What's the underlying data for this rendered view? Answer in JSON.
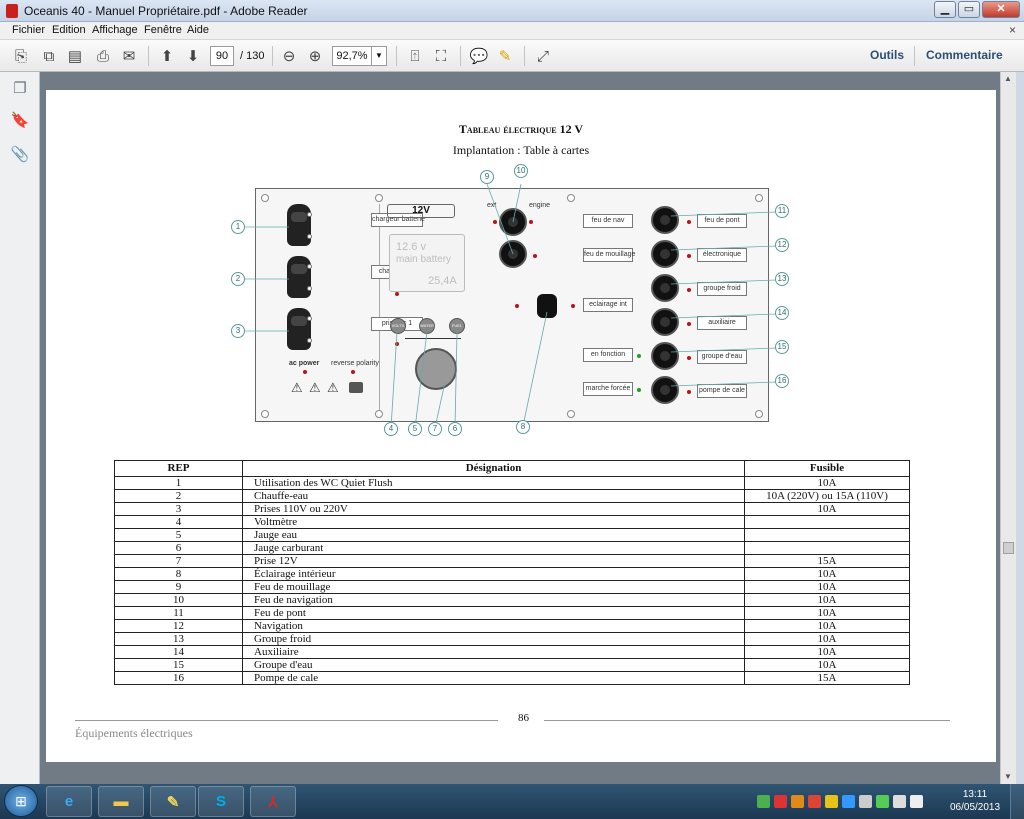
{
  "window": {
    "title": "Oceanis 40 - Manuel Propriétaire.pdf - Adobe Reader",
    "minimize_icon": "minimize-icon",
    "maximize_icon": "maximize-icon",
    "close_icon": "close-icon"
  },
  "menu": {
    "items": [
      "Fichier",
      "Edition",
      "Affichage",
      "Fenêtre",
      "Aide"
    ],
    "close_glyph": "×"
  },
  "toolbar": {
    "page_current": "90",
    "page_total": "/ 130",
    "zoom": "92,7%",
    "tools_label": "Outils",
    "comment_label": "Commentaire"
  },
  "page": {
    "title": "Tableau électrique 12 V",
    "subtitle": "Implantation : Table à cartes",
    "diagram": {
      "labels_left": [
        "chargeur batterie",
        "chauffe eau",
        "prise ac 1"
      ],
      "ac_power": "ac power",
      "reverse_polarity": "reverse polarity",
      "voltage_label": "12V",
      "lcd_line1": "12.6 v",
      "lcd_line2": "main battery",
      "lcd_line3": "25,4A",
      "knob_labels": [
        "VOLTS",
        "WATER",
        "FUEL"
      ],
      "anchor_labels": [
        "ext",
        "engine"
      ],
      "middle_labels": [
        "feu de nav",
        "feu de mouillage",
        "eclairage int",
        "en fonction",
        "marche forcée"
      ],
      "right_labels": [
        "feu de pont",
        "électronique",
        "groupe froid",
        "auxiliaire",
        "groupe d'eau",
        "pompe de cale"
      ],
      "callouts": [
        "1",
        "2",
        "3",
        "4",
        "5",
        "7",
        "6",
        "8",
        "9",
        "10",
        "11",
        "12",
        "13",
        "14",
        "15",
        "16"
      ]
    },
    "table": {
      "headers": [
        "REP",
        "Désignation",
        "Fusible"
      ],
      "rows": [
        [
          "1",
          "Utilisation des WC Quiet Flush",
          "10A"
        ],
        [
          "2",
          "Chauffe-eau",
          "10A (220V) ou 15A (110V)"
        ],
        [
          "3",
          "Prises 110V ou 220V",
          "10A"
        ],
        [
          "4",
          "Voltmètre",
          ""
        ],
        [
          "5",
          "Jauge eau",
          ""
        ],
        [
          "6",
          "Jauge carburant",
          ""
        ],
        [
          "7",
          "Prise 12V",
          "15A"
        ],
        [
          "8",
          "Éclairage intérieur",
          "10A"
        ],
        [
          "9",
          "Feu de mouillage",
          "10A"
        ],
        [
          "10",
          "Feu de navigation",
          "10A"
        ],
        [
          "11",
          "Feu de pont",
          "10A"
        ],
        [
          "12",
          "Navigation",
          "10A"
        ],
        [
          "13",
          "Groupe froid",
          "10A"
        ],
        [
          "14",
          "Auxiliaire",
          "10A"
        ],
        [
          "15",
          "Groupe d'eau",
          "10A"
        ],
        [
          "16",
          "Pompe de cale",
          "15A"
        ]
      ]
    },
    "page_number": "86",
    "footer": "Équipements électriques"
  },
  "taskbar": {
    "apps": [
      {
        "name": "internet-explorer",
        "glyph": "e",
        "color": "#3fa9f5"
      },
      {
        "name": "explorer",
        "glyph": "▬",
        "color": "#f3c74a"
      },
      {
        "name": "notes",
        "glyph": "✎",
        "color": "#f0d35a"
      },
      {
        "name": "skype",
        "glyph": "S",
        "color": "#00aff0"
      },
      {
        "name": "adobe-reader",
        "glyph": "⅄",
        "color": "#d72a23"
      }
    ],
    "time": "13:11",
    "date": "06/05/2013"
  }
}
